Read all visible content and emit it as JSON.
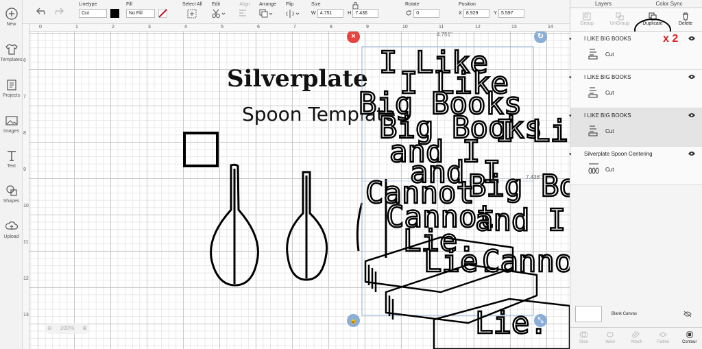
{
  "sidebar": {
    "items": [
      {
        "label": "New",
        "icon": "plus-circle-icon"
      },
      {
        "label": "Templates",
        "icon": "shirt-icon"
      },
      {
        "label": "Projects",
        "icon": "projects-icon"
      },
      {
        "label": "Images",
        "icon": "image-icon"
      },
      {
        "label": "Text",
        "icon": "text-icon"
      },
      {
        "label": "Shapes",
        "icon": "shapes-icon"
      },
      {
        "label": "Upload",
        "icon": "upload-icon"
      }
    ]
  },
  "toolbar": {
    "linetype_label": "Linetype",
    "linetype_value": "Cut",
    "fill_label": "Fill",
    "fill_value": "No Fill",
    "select_all_label": "Select All",
    "edit_label": "Edit",
    "align_label": "Align",
    "arrange_label": "Arrange",
    "flip_label": "Flip",
    "size_label": "Size",
    "w_label": "W",
    "w_value": "4.751",
    "h_label": "H",
    "h_value": "7.436",
    "rotate_label": "Rotate",
    "rotate_value": "0",
    "position_label": "Position",
    "x_label": "X",
    "x_value": "8.929",
    "y_label": "Y",
    "y_value": "5.597"
  },
  "ruler": {
    "top": [
      "0",
      "1",
      "2",
      "3",
      "4",
      "5",
      "6",
      "7",
      "8",
      "9",
      "10",
      "11",
      "12",
      "13",
      "14"
    ],
    "left": [
      "6",
      "7",
      "8",
      "9",
      "10",
      "11",
      "12",
      "13"
    ]
  },
  "canvas": {
    "width_readout": "4.751\"",
    "height_readout": "7.436\"",
    "zoom": "100%",
    "headline": "Silverplate",
    "subhead": "Spoon Template",
    "text_lines": [
      "I Like",
      "Big Books",
      "and I",
      "Cannot",
      "Lie."
    ],
    "annotation": "x 2"
  },
  "panel": {
    "tabs": [
      "Layers",
      "Color Sync"
    ],
    "tools": [
      {
        "label": "Group",
        "active": false
      },
      {
        "label": "UnGroup",
        "active": false
      },
      {
        "label": "Duplicate",
        "active": true
      },
      {
        "label": "Delete",
        "active": true
      }
    ],
    "layers": [
      {
        "name": "I LIKE BIG BOOKS",
        "sub": "Cut",
        "selected": false
      },
      {
        "name": "I LIKE BIG BOOKS",
        "sub": "Cut",
        "selected": false
      },
      {
        "name": "I LIKE BIG BOOKS",
        "sub": "Cut",
        "selected": true
      },
      {
        "name": "Silverplate Spoon Centering",
        "sub": "Cut",
        "selected": false
      }
    ],
    "blank_canvas": "Blank Canvas",
    "bottom_tools": [
      {
        "label": "Slice",
        "active": false
      },
      {
        "label": "Weld",
        "active": false
      },
      {
        "label": "Attach",
        "active": false
      },
      {
        "label": "Flatten",
        "active": false
      },
      {
        "label": "Contour",
        "active": true
      }
    ]
  },
  "colors": {
    "accent_red": "#e8433e",
    "handle_blue": "#7fa7d6",
    "annotation_red": "#e0201e"
  }
}
